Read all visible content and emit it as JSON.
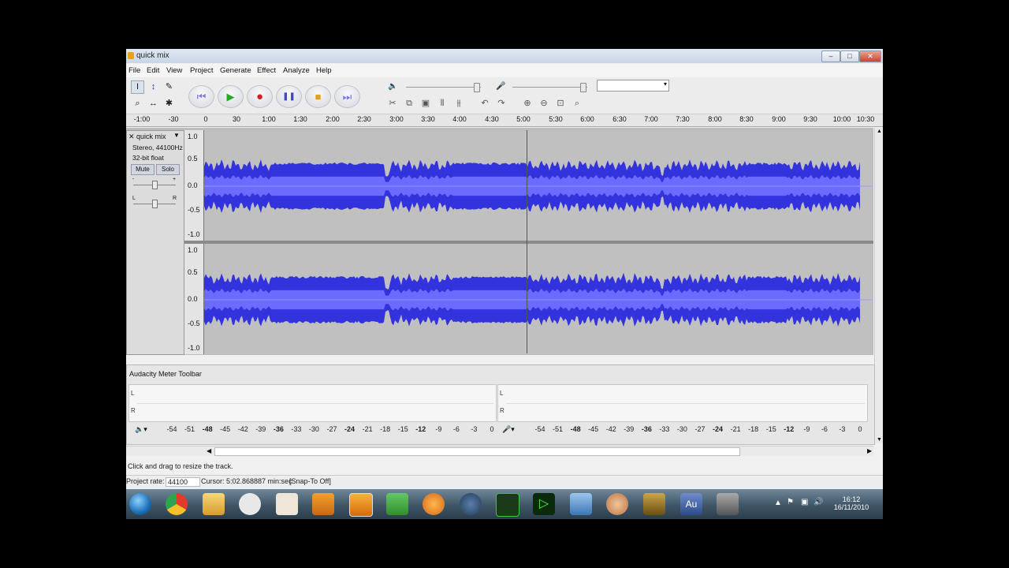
{
  "window": {
    "title": "quick mix",
    "min": "–",
    "max": "□",
    "close": "✕"
  },
  "menu": [
    "File",
    "Edit",
    "View",
    "Project",
    "Generate",
    "Effect",
    "Analyze",
    "Help"
  ],
  "tools": {
    "select": "I",
    "envelope": "↕",
    "draw": "✎",
    "zoom": "⌕",
    "timeshift": "↔",
    "multi": "✱"
  },
  "transport": {
    "skip_start": "⏮",
    "play": "▶",
    "record": "●",
    "pause": "❚❚",
    "stop": "■",
    "skip_end": "⏭"
  },
  "edit_icons": [
    "✂",
    "⧉",
    "▣",
    "⫴",
    "⫵",
    "↶",
    "↷",
    "⊕",
    "⊖",
    "⊡",
    "⌕"
  ],
  "ruler": [
    "-1:00",
    "-30",
    "0",
    "30",
    "1:00",
    "1:30",
    "2:00",
    "2:30",
    "3:00",
    "3:30",
    "4:00",
    "4:30",
    "5:00",
    "5:30",
    "6:00",
    "6:30",
    "7:00",
    "7:30",
    "8:00",
    "8:30",
    "9:00",
    "9:30",
    "10:00",
    "10:30"
  ],
  "track": {
    "name": "quick mix",
    "info1": "Stereo, 44100Hz",
    "info2": "32-bit float",
    "mute": "Mute",
    "solo": "Solo",
    "gain_minus": "-",
    "gain_plus": "+",
    "pan_l": "L",
    "pan_r": "R"
  },
  "vscale": [
    "1.0",
    "0.5",
    "0.0",
    "-0.5",
    "-1.0"
  ],
  "meter": {
    "title": "Audacity Meter Toolbar",
    "L": "L",
    "R": "R",
    "scale": [
      "-54",
      "-51",
      "-48",
      "-45",
      "-42",
      "-39",
      "-36",
      "-33",
      "-30",
      "-27",
      "-24",
      "-21",
      "-18",
      "-15",
      "-12",
      "-9",
      "-6",
      "-3",
      "0"
    ]
  },
  "status": {
    "hint": "Click and drag to resize the track.",
    "rate_label": "Project rate:",
    "rate": "44100",
    "cursor": "Cursor: 5:02.868887 min:sec",
    "snap": "[Snap-To Off]"
  },
  "taskbar": {
    "time": "16:12",
    "date": "16/11/2010",
    "audition": "Au"
  },
  "colors": {
    "wave": "#3333dd",
    "wave_light": "#6b6bff",
    "rms": "#5555ee"
  }
}
